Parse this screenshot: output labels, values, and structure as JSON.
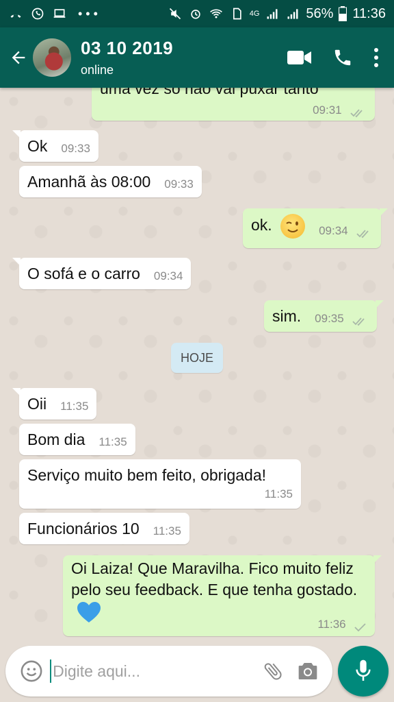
{
  "status_bar": {
    "network": "4G",
    "battery": "56%",
    "time": "11:36"
  },
  "header": {
    "contact_name": "03 10 2019",
    "contact_status": "online"
  },
  "messages": [
    {
      "text": "uma vez só não vai puxar tanto",
      "time": "09:31",
      "direction": "out",
      "ticks": "read"
    },
    {
      "text": "Ok",
      "time": "09:33",
      "direction": "in"
    },
    {
      "text": "Amanhã às 08:00",
      "time": "09:33",
      "direction": "in"
    },
    {
      "text": "ok.",
      "time": "09:34",
      "direction": "out",
      "ticks": "read"
    },
    {
      "text": "O sofá e o carro",
      "time": "09:34",
      "direction": "in"
    },
    {
      "text": "sim.",
      "time": "09:35",
      "direction": "out",
      "ticks": "read"
    },
    {
      "text": "Oii",
      "time": "11:35",
      "direction": "in"
    },
    {
      "text": "Bom dia",
      "time": "11:35",
      "direction": "in"
    },
    {
      "text": "Serviço muito bem feito, obrigada!",
      "time": "11:35",
      "direction": "in"
    },
    {
      "text": "Funcionários 10",
      "time": "11:35",
      "direction": "in"
    },
    {
      "text": "Oi Laiza! Que Maravilha. Fico muito feliz pelo seu feedback. E que tenha gostado.",
      "time": "11:36",
      "direction": "out",
      "ticks": "sent"
    }
  ],
  "date_divider": "HOJE",
  "composer": {
    "placeholder": "Digite aqui..."
  },
  "colors": {
    "header": "#075e54",
    "status_bar": "#054d44",
    "outgoing_bubble": "#dcf8c6",
    "incoming_bubble": "#ffffff",
    "accent": "#00897b",
    "read_ticks": "#4fc3f7"
  },
  "icons": [
    "back-arrow-icon",
    "video-call-icon",
    "phone-icon",
    "more-vert-icon",
    "emoji-icon",
    "attach-icon",
    "camera-icon",
    "mic-icon"
  ]
}
